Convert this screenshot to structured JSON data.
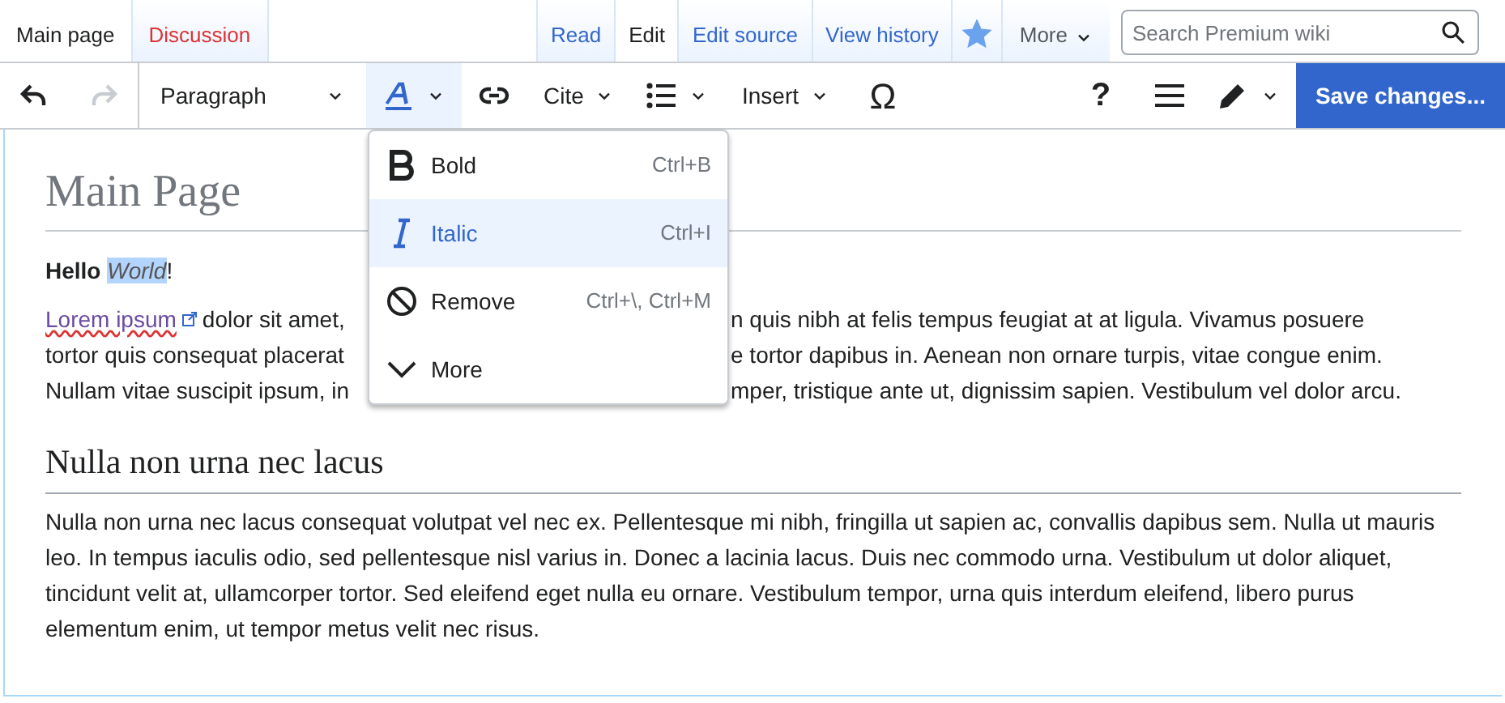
{
  "page_tabs": [
    {
      "label": "Main page",
      "selected": true,
      "kind": "page"
    },
    {
      "label": "Discussion",
      "selected": false,
      "kind": "missing"
    }
  ],
  "view_tabs": [
    {
      "label": "Read",
      "selected": false
    },
    {
      "label": "Edit",
      "selected": true
    },
    {
      "label": "Edit source",
      "selected": false
    },
    {
      "label": "View history",
      "selected": false
    }
  ],
  "watch": {
    "on": true
  },
  "more_menu": {
    "label": "More"
  },
  "search": {
    "placeholder": "Search Premium wiki"
  },
  "toolbar": {
    "left": [
      {
        "kind": "undo",
        "disabled": false,
        "expanded": false
      },
      {
        "kind": "redo",
        "disabled": true,
        "expanded": false
      },
      {
        "kind": "format",
        "label": "Paragraph",
        "disabled": false,
        "expanded": false
      },
      {
        "kind": "style",
        "disabled": false,
        "expanded": true
      },
      {
        "kind": "link",
        "disabled": false,
        "expanded": false
      },
      {
        "kind": "cite",
        "label": "Cite",
        "disabled": false,
        "expanded": false
      },
      {
        "kind": "list",
        "disabled": false,
        "expanded": false
      },
      {
        "kind": "insert",
        "label": "Insert",
        "disabled": false,
        "expanded": false
      },
      {
        "kind": "special",
        "label": "Ω",
        "disabled": false,
        "expanded": false
      }
    ],
    "right": [
      {
        "kind": "help",
        "label": "?"
      },
      {
        "kind": "menu"
      },
      {
        "kind": "edit-mode"
      }
    ],
    "save_button": "Save changes..."
  },
  "style_menu": [
    {
      "kind": "bold",
      "label": "Bold",
      "shortcut": "Ctrl+B",
      "selected": false
    },
    {
      "kind": "italic",
      "label": "Italic",
      "shortcut": "Ctrl+I",
      "selected": true
    },
    {
      "kind": "remove",
      "label": "Remove",
      "shortcut": "Ctrl+\\, Ctrl+M",
      "selected": false
    },
    {
      "kind": "more",
      "label": "More",
      "selected": false
    }
  ],
  "content": {
    "title": "Main Page",
    "greeting": {
      "bold": "Hello",
      "selected_word": "World",
      "rest": "!"
    },
    "paragraph_lines": [
      {
        "link": "Lorem ipsum",
        "left": "dolor sit amet,",
        "right": "n quis nibh at felis tempus feugiat at at ligula. Vivamus posuere"
      },
      {
        "left": "tortor quis consequat placerat",
        "right": "e tortor dapibus in. Aenean non ornare turpis, vitae congue enim."
      },
      {
        "left": "Nullam vitae suscipit ipsum, in",
        "right": "mper, tristique ante ut, dignissim sapien. Vestibulum vel dolor arcu."
      }
    ],
    "heading": "Nulla non urna nec lacus",
    "paragraph": "Nulla non urna nec lacus consequat volutpat vel nec ex. Pellentesque mi nibh, fringilla ut sapien ac, convallis dapibus sem. Nulla ut mauris leo. In tempus iaculis odio, sed pellentesque nisl varius in. Donec a lacinia lacus. Duis nec commodo urna. Vestibulum ut dolor aliquet, tincidunt velit at, ullamcorper tortor. Sed eleifend eget nulla eu ornare. Vestibulum tempor, urna quis interdum eleifend, libero purus elementum enim, ut tempor metus velit nec risus."
  }
}
